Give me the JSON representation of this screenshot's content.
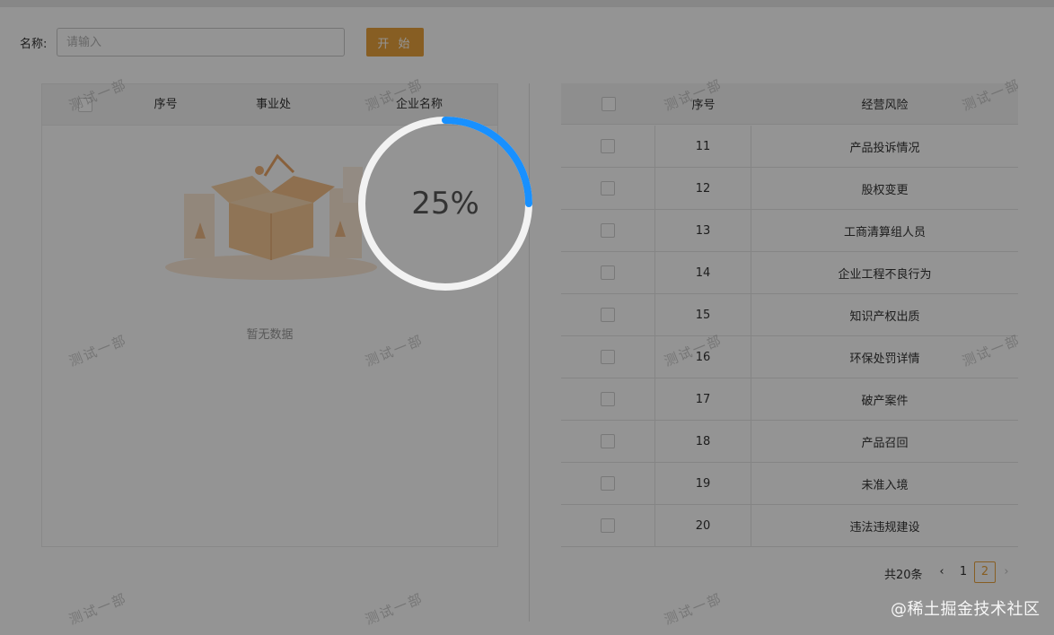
{
  "search": {
    "label": "名称:",
    "value": "",
    "placeholder": "请输入",
    "start_button": "开 始"
  },
  "left_table": {
    "columns": [
      "序号",
      "事业处",
      "企业名称"
    ],
    "empty_text": "暂无数据"
  },
  "right_table": {
    "columns": [
      "序号",
      "经营风险"
    ],
    "rows": [
      {
        "index": "11",
        "risk": "产品投诉情况"
      },
      {
        "index": "12",
        "risk": "股权变更"
      },
      {
        "index": "13",
        "risk": "工商清算组人员"
      },
      {
        "index": "14",
        "risk": "企业工程不良行为"
      },
      {
        "index": "15",
        "risk": "知识产权出质"
      },
      {
        "index": "16",
        "risk": "环保处罚详情"
      },
      {
        "index": "17",
        "risk": "破产案件"
      },
      {
        "index": "18",
        "risk": "产品召回"
      },
      {
        "index": "19",
        "risk": "未准入境"
      },
      {
        "index": "20",
        "risk": "违法违规建设"
      }
    ]
  },
  "pagination": {
    "total": "共20条",
    "pages": [
      "1",
      "2"
    ],
    "current": "2"
  },
  "progress": {
    "percent_text": "25%",
    "value": 0.25,
    "track_color": "#f2f2f2",
    "bar_color": "#1890ff"
  },
  "watermark_text": "测试一部",
  "brand_watermark": "@稀土掘金技术社区",
  "colors": {
    "accent": "#e8a33d"
  }
}
